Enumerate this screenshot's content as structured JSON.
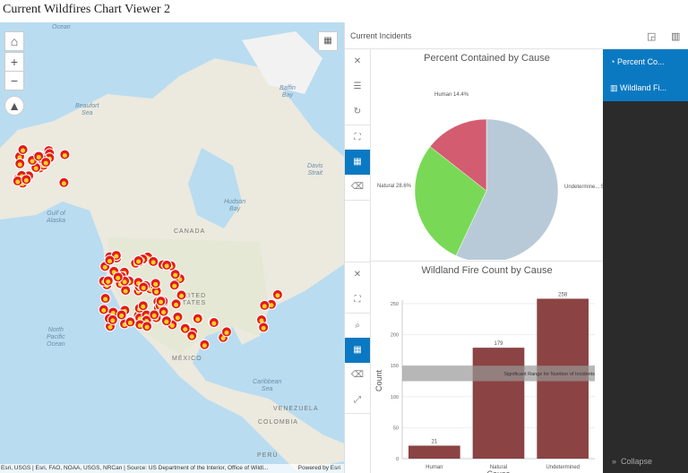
{
  "app_title": "Current Wildfires Chart Viewer 2",
  "map": {
    "zoom_in": "+",
    "zoom_out": "−",
    "labels": {
      "ocean_top": "Ocean",
      "beaufort": "Beaufort\nSea",
      "baffin": "Baffin\nBay",
      "davis": "Davis\nStrait",
      "hudson": "Hudson\nBay",
      "gulf_alaska": "Gulf of\nAlaska",
      "canada": "CANADA",
      "united_states": "UNITED\nSTATES",
      "mexico": "MÉXICO",
      "north_pacific": "North\nPacific\nOcean",
      "caribbean": "Caribbean\nSea",
      "venezuela": "VENEZUELA",
      "colombia": "COLOMBIA",
      "peru": "PERÚ"
    },
    "attribution": "Esri, USGS | Esri, FAO, NOAA, USGS, NRCan | Source: US Department of the Interior, Office of Wildl...",
    "powered_by": "Powered by Esri"
  },
  "panel": {
    "header_title": "Current Incidents",
    "charts_list": [
      {
        "label": "Percent Co...",
        "icon": "pie-chart-icon"
      },
      {
        "label": "Wildland Fi...",
        "icon": "bar-chart-icon"
      }
    ],
    "collapse_label": "Collapse"
  },
  "colors": {
    "accent": "#0b79c2",
    "human": "#d45c70",
    "natural": "#79d957",
    "undetermined": "#b8cad8",
    "bar": "#8b4343",
    "band": "#999999"
  },
  "chart_data": [
    {
      "type": "pie",
      "title": "Percent Contained by Cause",
      "slices": [
        {
          "label": "Undetermined",
          "value": 57.0,
          "display": "Undetermine... 5"
        },
        {
          "label": "Natural",
          "value": 28.6,
          "display": "Natural 28.6%"
        },
        {
          "label": "Human",
          "value": 14.4,
          "display": "Human 14.4%"
        }
      ]
    },
    {
      "type": "bar",
      "title": "Wildland Fire Count by Cause",
      "xlabel": "Cause",
      "ylabel": "Count",
      "categories": [
        "Human",
        "Natural",
        "Undetermined"
      ],
      "values": [
        21,
        179,
        258
      ],
      "ylim": [
        0,
        260
      ],
      "yticks": [
        0,
        50,
        100,
        150,
        200,
        250
      ],
      "grid": true,
      "band": {
        "from": 125,
        "to": 150,
        "label": "Significant Range for Number of Incidents"
      }
    }
  ]
}
